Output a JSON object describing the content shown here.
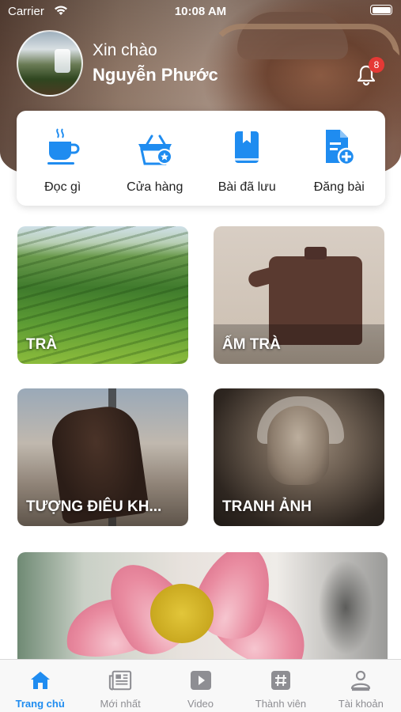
{
  "status_bar": {
    "carrier": "Carrier",
    "time": "10:08 AM"
  },
  "header": {
    "greeting": "Xin chào",
    "user_name": "Nguyễn Phước",
    "notification_count": "8"
  },
  "quick_actions": [
    {
      "label": "Đọc gì",
      "icon": "coffee-cup-icon"
    },
    {
      "label": "Cửa hàng",
      "icon": "shopping-basket-icon"
    },
    {
      "label": "Bài đã lưu",
      "icon": "bookmark-book-icon"
    },
    {
      "label": "Đăng bài",
      "icon": "add-document-icon"
    }
  ],
  "categories": [
    {
      "label": "TRÀ"
    },
    {
      "label": "ẤM TRÀ"
    },
    {
      "label": "TƯỢNG ĐIÊU KH..."
    },
    {
      "label": "TRANH ẢNH"
    }
  ],
  "tabbar": {
    "active": "home",
    "items": [
      {
        "label": "Trang chủ",
        "icon": "home-icon"
      },
      {
        "label": "Mới nhất",
        "icon": "newspaper-icon"
      },
      {
        "label": "Video",
        "icon": "play-icon"
      },
      {
        "label": "Thành viên",
        "icon": "hashtag-icon"
      },
      {
        "label": "Tài khoản",
        "icon": "user-icon"
      }
    ]
  },
  "colors": {
    "accent": "#1f8cf0",
    "badge": "#e53935",
    "inactive": "#8e8e93"
  }
}
